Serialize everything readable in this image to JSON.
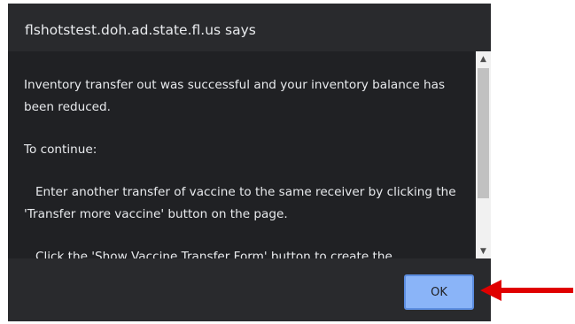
{
  "dialog": {
    "title": "flshotstest.doh.ad.state.fl.us says",
    "message": [
      "Inventory transfer out was successful and your inventory balance has been reduced.",
      "To continue:",
      "   Enter another transfer of vaccine to the same receiver by clicking the 'Transfer more vaccine' button on the page.",
      "   Click the 'Show Vaccine Transfer Form' button to create the"
    ],
    "ok_label": "OK"
  },
  "scrollbar": {
    "up_arrow": "▲",
    "down_arrow": "▼"
  },
  "icons": {
    "annotation": "red-arrow-icon"
  },
  "colors": {
    "dialog_bg": "#292a2d",
    "message_bg": "#202124",
    "button_bg": "#8ab4f8",
    "annotation": "#e00000"
  }
}
